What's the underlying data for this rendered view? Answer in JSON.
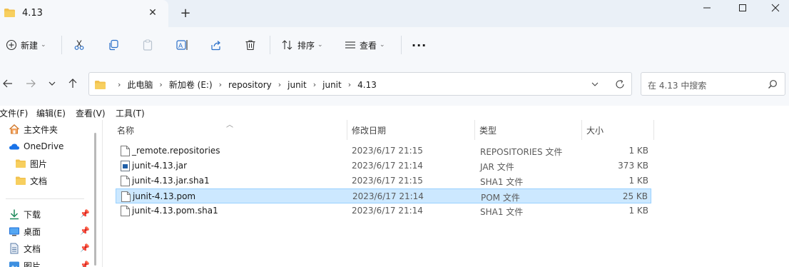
{
  "tab": {
    "title": "4.13",
    "close": "✕",
    "new_tab": "+"
  },
  "toolbar": {
    "new_label": "新建",
    "sort_label": "排序",
    "view_label": "查看",
    "more_label": "···"
  },
  "address": {
    "crumbs": [
      "此电脑",
      "新加卷 (E:)",
      "repository",
      "junit",
      "junit",
      "4.13"
    ]
  },
  "search": {
    "placeholder": "在 4.13 中搜索"
  },
  "menubar": {
    "file": "文件(F)",
    "edit": "编辑(E)",
    "view": "查看(V)",
    "tools": "工具(T)"
  },
  "sidebar": {
    "items": [
      {
        "label": "主文件夹",
        "icon": "home-icon"
      },
      {
        "label": "OneDrive",
        "icon": "cloud-icon"
      },
      {
        "label": "图片",
        "icon": "folder-icon"
      },
      {
        "label": "文档",
        "icon": "folder-icon"
      },
      {
        "label": "下载",
        "icon": "download-icon"
      },
      {
        "label": "桌面",
        "icon": "desktop-icon"
      },
      {
        "label": "文档",
        "icon": "document-icon"
      },
      {
        "label": "图片",
        "icon": "pictures-icon"
      }
    ]
  },
  "columns": {
    "name": "名称",
    "modified": "修改日期",
    "type": "类型",
    "size": "大小"
  },
  "files": [
    {
      "name": "_remote.repositories",
      "modified": "2023/6/17 21:15",
      "type": "REPOSITORIES 文件",
      "size": "1 KB",
      "icon": "file-icon",
      "selected": false
    },
    {
      "name": "junit-4.13.jar",
      "modified": "2023/6/17 21:14",
      "type": "JAR 文件",
      "size": "373 KB",
      "icon": "jar-icon",
      "selected": false
    },
    {
      "name": "junit-4.13.jar.sha1",
      "modified": "2023/6/17 21:15",
      "type": "SHA1 文件",
      "size": "1 KB",
      "icon": "file-icon",
      "selected": false
    },
    {
      "name": "junit-4.13.pom",
      "modified": "2023/6/17 21:14",
      "type": "POM 文件",
      "size": "25 KB",
      "icon": "file-icon",
      "selected": true
    },
    {
      "name": "junit-4.13.pom.sha1",
      "modified": "2023/6/17 21:14",
      "type": "SHA1 文件",
      "size": "1 KB",
      "icon": "file-icon",
      "selected": false
    }
  ],
  "colors": {
    "accent": "#0067c0",
    "selection_bg": "#cce8ff",
    "selection_border": "#99d1ff",
    "folder": "#f2c14e"
  }
}
